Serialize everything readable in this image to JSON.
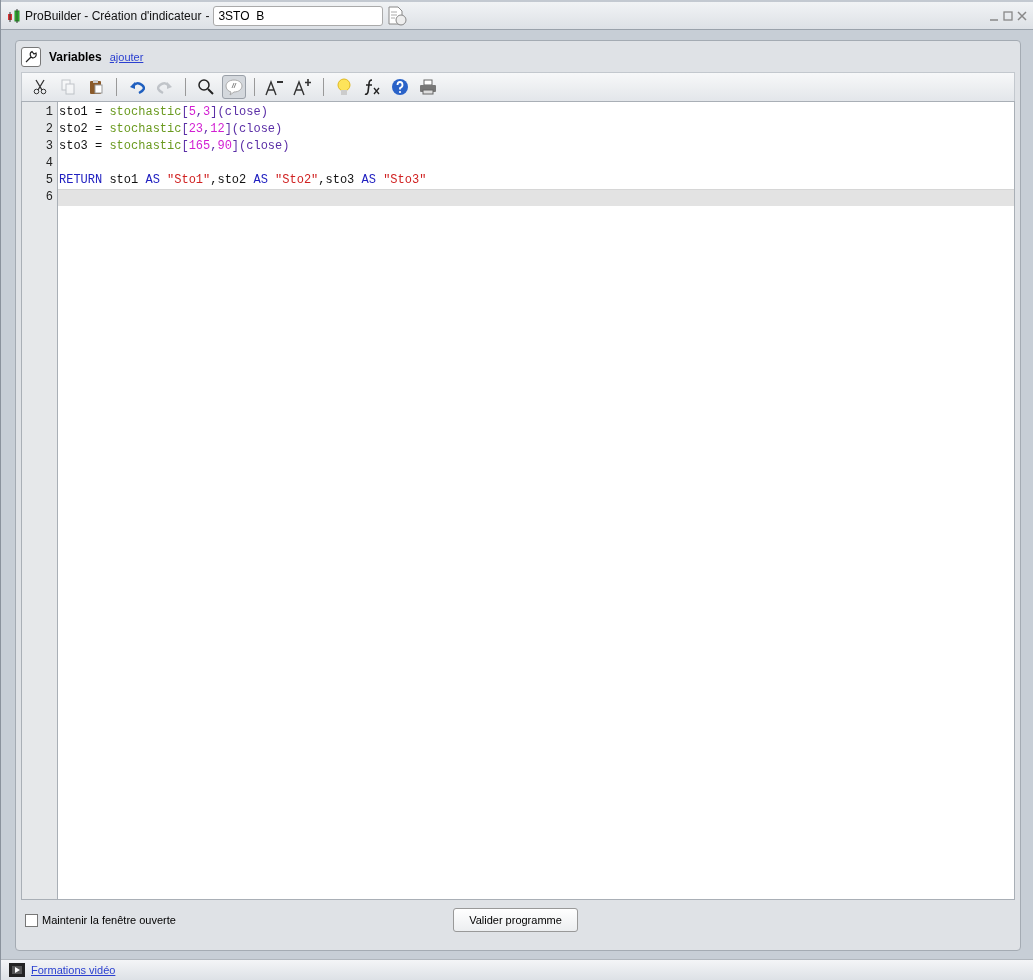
{
  "window": {
    "title": "ProBuilder - Création d'indicateur",
    "separator": "-",
    "name_value": "3STO  B"
  },
  "panel": {
    "title": "Variables",
    "link": "ajouter"
  },
  "toolbar": [
    {
      "kind": "cut",
      "disabled": false,
      "pressed": false
    },
    {
      "kind": "copy",
      "disabled": true,
      "pressed": false
    },
    {
      "kind": "paste",
      "disabled": false,
      "pressed": false
    },
    {
      "kind": "sep"
    },
    {
      "kind": "undo",
      "disabled": false,
      "pressed": false
    },
    {
      "kind": "redo",
      "disabled": true,
      "pressed": false
    },
    {
      "kind": "sep"
    },
    {
      "kind": "search",
      "disabled": false,
      "pressed": false
    },
    {
      "kind": "comment",
      "disabled": false,
      "pressed": true
    },
    {
      "kind": "sep"
    },
    {
      "kind": "font-smaller",
      "disabled": false,
      "pressed": false
    },
    {
      "kind": "font-larger",
      "disabled": false,
      "pressed": false
    },
    {
      "kind": "sep"
    },
    {
      "kind": "bulb",
      "disabled": false,
      "pressed": false
    },
    {
      "kind": "fx",
      "disabled": false,
      "pressed": false
    },
    {
      "kind": "help",
      "disabled": false,
      "pressed": false
    },
    {
      "kind": "print",
      "disabled": false,
      "pressed": false
    }
  ],
  "editor": {
    "lines": [
      {
        "number": "1",
        "selected": false,
        "tokens": [
          {
            "kind": "plain",
            "text": "sto1 = "
          },
          {
            "kind": "func",
            "text": "stochastic"
          },
          {
            "kind": "punct",
            "text": "["
          },
          {
            "kind": "num",
            "text": "5"
          },
          {
            "kind": "punct",
            "text": ","
          },
          {
            "kind": "num",
            "text": "3"
          },
          {
            "kind": "punct",
            "text": "](close)"
          }
        ]
      },
      {
        "number": "2",
        "selected": false,
        "tokens": [
          {
            "kind": "plain",
            "text": "sto2 = "
          },
          {
            "kind": "func",
            "text": "stochastic"
          },
          {
            "kind": "punct",
            "text": "["
          },
          {
            "kind": "num",
            "text": "23"
          },
          {
            "kind": "punct",
            "text": ","
          },
          {
            "kind": "num",
            "text": "12"
          },
          {
            "kind": "punct",
            "text": "](close)"
          }
        ]
      },
      {
        "number": "3",
        "selected": false,
        "tokens": [
          {
            "kind": "plain",
            "text": "sto3 = "
          },
          {
            "kind": "func",
            "text": "stochastic"
          },
          {
            "kind": "punct",
            "text": "["
          },
          {
            "kind": "num",
            "text": "165"
          },
          {
            "kind": "punct",
            "text": ","
          },
          {
            "kind": "num",
            "text": "90"
          },
          {
            "kind": "punct",
            "text": "](close)"
          }
        ]
      },
      {
        "number": "4",
        "selected": false
      },
      {
        "number": "5",
        "selected": false,
        "tokens": [
          {
            "kind": "keyword",
            "text": "RETURN"
          },
          {
            "kind": "plain",
            "text": " sto1 "
          },
          {
            "kind": "keyword",
            "text": "AS"
          },
          {
            "kind": "string",
            "text": " \"Sto1\""
          },
          {
            "kind": "plain",
            "text": ",sto2 "
          },
          {
            "kind": "keyword",
            "text": "AS"
          },
          {
            "kind": "string",
            "text": " \"Sto2\""
          },
          {
            "kind": "plain",
            "text": ",sto3 "
          },
          {
            "kind": "keyword",
            "text": "AS"
          },
          {
            "kind": "string",
            "text": " \"Sto3\""
          }
        ]
      },
      {
        "number": "6",
        "selected": true
      }
    ]
  },
  "footer": {
    "checkbox_label": "Maintenir la fenêtre ouverte",
    "checked": false,
    "button": "Valider programme"
  },
  "status_bar": {
    "link": "Formations vidéo"
  }
}
